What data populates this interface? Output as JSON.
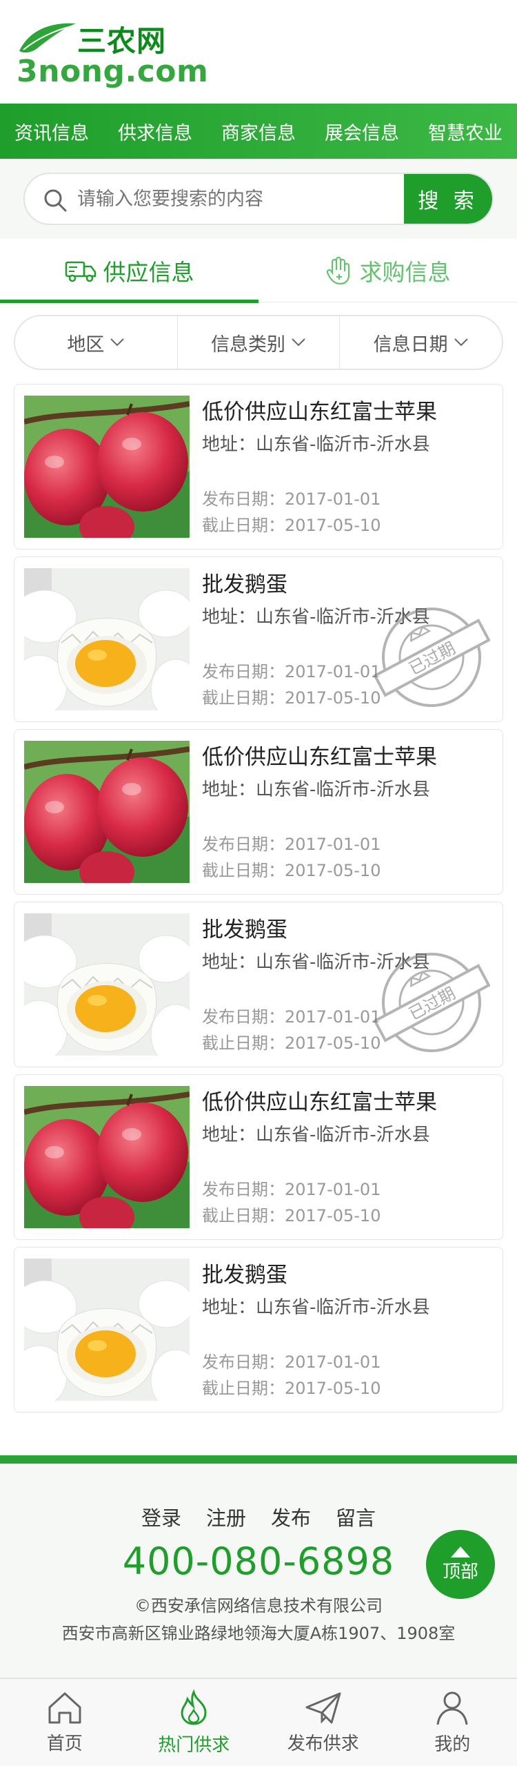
{
  "logo": {
    "cn": "三农网",
    "en": "3nong.com"
  },
  "nav": [
    "资讯信息",
    "供求信息",
    "商家信息",
    "展会信息",
    "智慧农业"
  ],
  "search": {
    "placeholder": "请输入您要搜索的内容",
    "button": "搜 索"
  },
  "tabs": {
    "supply": "供应信息",
    "demand": "求购信息"
  },
  "filters": [
    "地区",
    "信息类别",
    "信息日期"
  ],
  "listings": [
    {
      "title": "低价供应山东红富士苹果",
      "address": "地址：山东省-临沂市-沂水县",
      "published": "发布日期：2017-01-01",
      "deadline": "截止日期：2017-05-10",
      "image": "apples-photo",
      "expired": false
    },
    {
      "title": "批发鹅蛋",
      "address": "地址：山东省-临沂市-沂水县",
      "published": "发布日期：2017-01-01",
      "deadline": "截止日期：2017-05-10",
      "image": "goose-egg-photo",
      "expired": true
    },
    {
      "title": "低价供应山东红富士苹果",
      "address": "地址：山东省-临沂市-沂水县",
      "published": "发布日期：2017-01-01",
      "deadline": "截止日期：2017-05-10",
      "image": "apples-photo",
      "expired": false
    },
    {
      "title": "批发鹅蛋",
      "address": "地址：山东省-临沂市-沂水县",
      "published": "发布日期：2017-01-01",
      "deadline": "截止日期：2017-05-10",
      "image": "goose-egg-photo",
      "expired": true
    },
    {
      "title": "低价供应山东红富士苹果",
      "address": "地址：山东省-临沂市-沂水县",
      "published": "发布日期：2017-01-01",
      "deadline": "截止日期：2017-05-10",
      "image": "apples-photo",
      "expired": false
    },
    {
      "title": "批发鹅蛋",
      "address": "地址：山东省-临沂市-沂水县",
      "published": "发布日期：2017-01-01",
      "deadline": "截止日期：2017-05-10",
      "image": "goose-egg-photo",
      "expired": false
    }
  ],
  "stamp": {
    "text": "已过期",
    "ring_text": "Information Expired · www.3nong.com"
  },
  "footer": {
    "links": [
      "登录",
      "注册",
      "发布",
      "留言"
    ],
    "phone": "400-080-6898",
    "company": "©西安承信网络信息技术有限公司",
    "address": "西安市高新区锦业路绿地领海大厦A栋1907、1908室",
    "top_button": "顶部"
  },
  "tabbar": [
    {
      "label": "首页",
      "icon": "home-icon",
      "active": false
    },
    {
      "label": "热门供求",
      "icon": "flame-icon",
      "active": true
    },
    {
      "label": "发布供求",
      "icon": "paper-plane-icon",
      "active": false
    },
    {
      "label": "我的",
      "icon": "user-icon",
      "active": false
    }
  ],
  "colors": {
    "brand": "#1f9e2c",
    "brand_light": "#63c26e",
    "background": "#f6f8f6"
  }
}
